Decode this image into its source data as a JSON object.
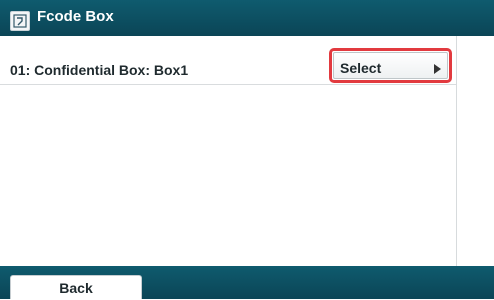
{
  "window": {
    "title": "Fcode Box",
    "icon": "fcode-box-icon"
  },
  "list": {
    "rows": [
      {
        "label": "01: Confidential Box: Box1",
        "action_label": "Select",
        "action_icon": "play-arrow-icon"
      }
    ]
  },
  "footer": {
    "back_label": "Back"
  },
  "colors": {
    "bar": "#0f5b6e",
    "highlight": "#e23a3f"
  }
}
